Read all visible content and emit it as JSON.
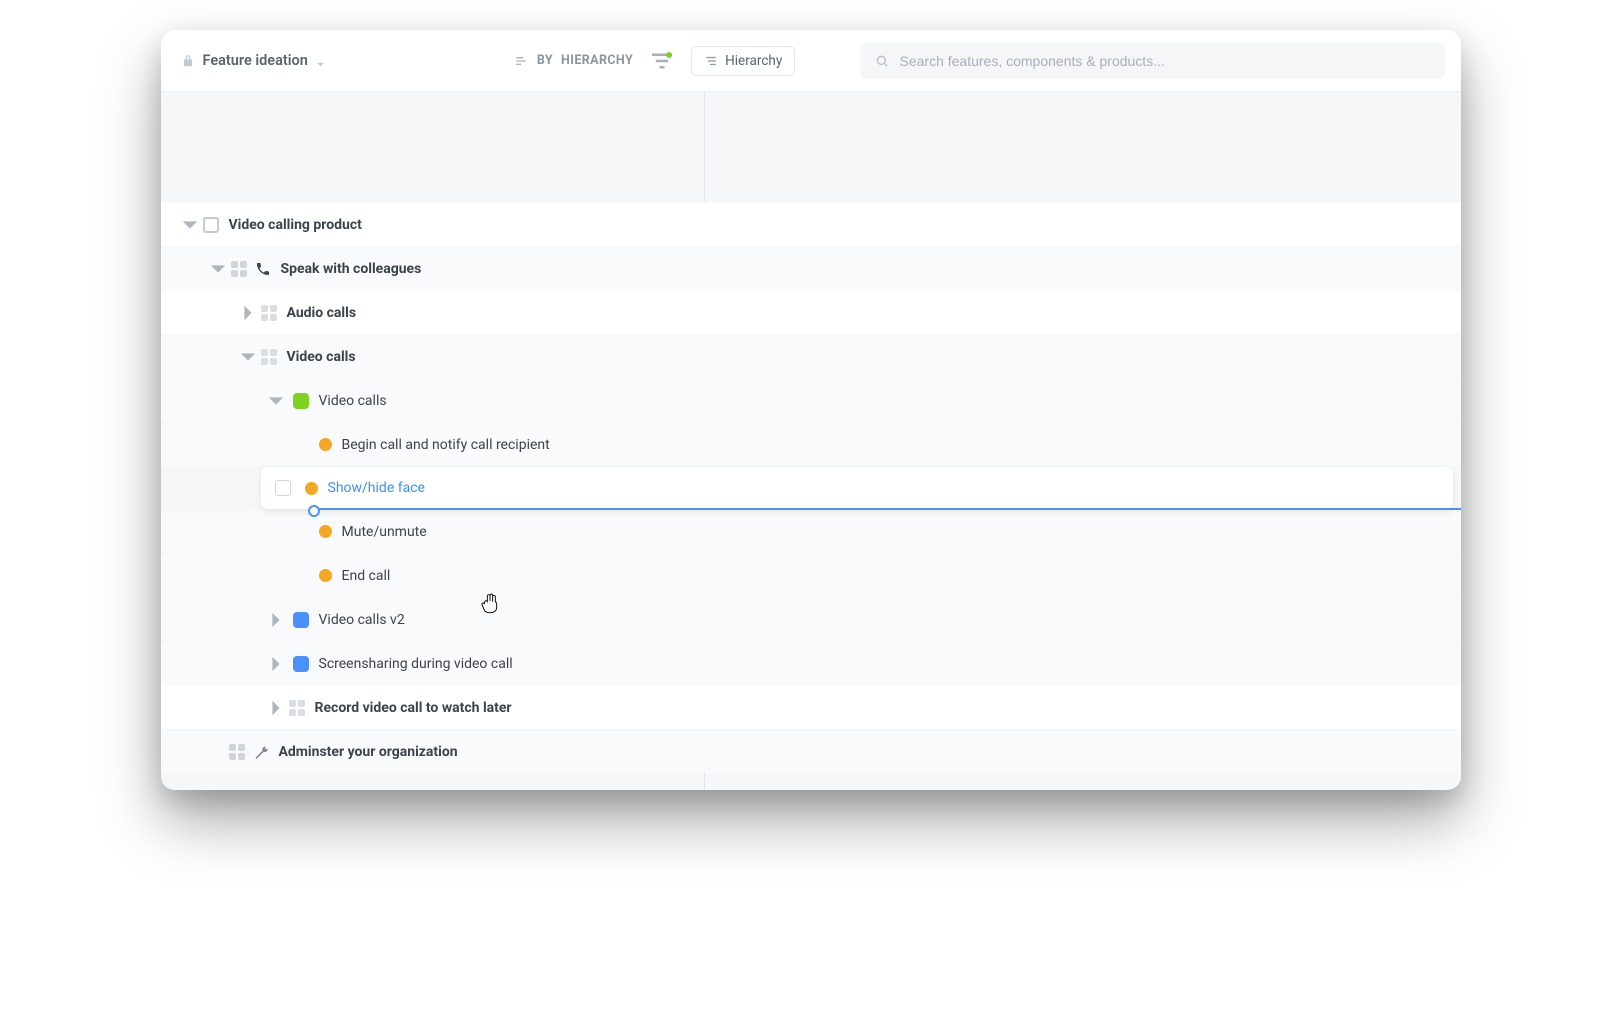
{
  "header": {
    "title": "Feature ideation",
    "sort_prefix": "BY",
    "sort_value": "HIERARCHY",
    "view_label": "Hierarchy",
    "search_placeholder": "Search features, components & products..."
  },
  "tree": {
    "root": "Video calling product",
    "speak": "Speak with colleagues",
    "audio": "Audio calls",
    "video_group": "Video calls",
    "video_calls": "Video calls",
    "begin": "Begin call and notify call recipient",
    "showhide": "Show/hide face",
    "mute": "Mute/unmute",
    "end": "End call",
    "v2": "Video calls v2",
    "screenshare": "Screensharing during video call",
    "record": "Record video call to watch later",
    "admin": "Adminster your organization"
  },
  "colors": {
    "green": "#7ed321",
    "blue": "#4a90ff",
    "orange": "#f5a623"
  }
}
